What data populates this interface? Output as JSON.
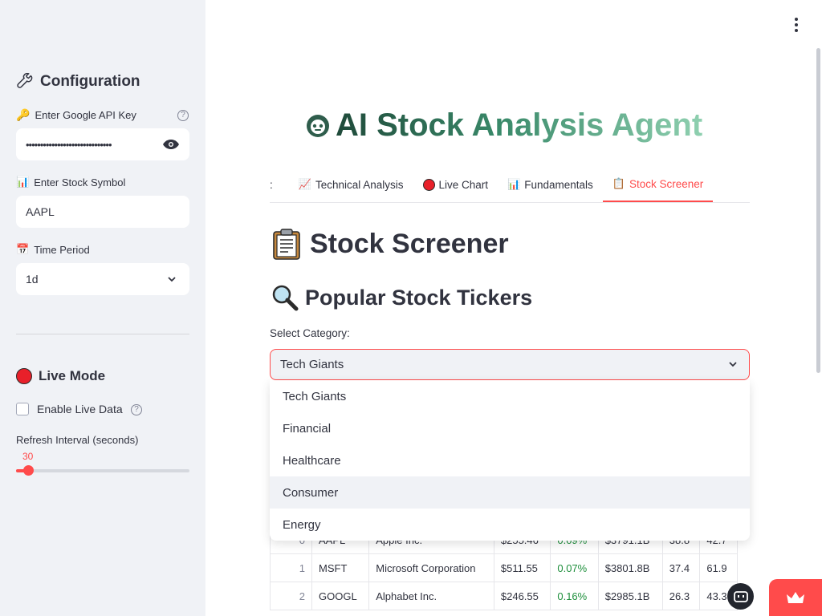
{
  "sidebar": {
    "config_heading": "Configuration",
    "api_key_label": "Enter Google API Key",
    "api_key_value": "••••••••••••••••••••••••••••••",
    "symbol_label": "Enter Stock Symbol",
    "symbol_value": "AAPL",
    "period_label": "Time Period",
    "period_value": "1d",
    "live_heading": "Live Mode",
    "live_checkbox_label": "Enable Live Data",
    "refresh_label": "Refresh Interval (seconds)",
    "refresh_value": "30",
    "refresh_fraction": 0.07
  },
  "main": {
    "title": "AI Stock Analysis Agent",
    "tabs": [
      {
        "label": ":"
      },
      {
        "label": "Technical Analysis"
      },
      {
        "label": "Live Chart"
      },
      {
        "label": "Fundamentals"
      },
      {
        "label": "Stock Screener"
      }
    ],
    "page_heading": "Stock Screener",
    "section_heading": "Popular Stock Tickers",
    "category_label": "Select Category:",
    "category_selected": "Tech Giants",
    "category_options": [
      "Tech Giants",
      "Financial",
      "Healthcare",
      "Consumer",
      "Energy"
    ],
    "table_rows": [
      {
        "idx": "0",
        "ticker": "AAPL",
        "name": "Apple Inc.",
        "price": "$255.46",
        "change": "0.09%",
        "cap": "$3791.1B",
        "pe": "38.8",
        "c7": "42.7"
      },
      {
        "idx": "1",
        "ticker": "MSFT",
        "name": "Microsoft Corporation",
        "price": "$511.55",
        "change": "0.07%",
        "cap": "$3801.8B",
        "pe": "37.4",
        "c7": "61.9"
      },
      {
        "idx": "2",
        "ticker": "GOOGL",
        "name": "Alphabet Inc.",
        "price": "$246.55",
        "change": "0.16%",
        "cap": "$2985.1B",
        "pe": "26.3",
        "c7": "43.3"
      }
    ]
  },
  "colors": {
    "accent": "#ff4b4b",
    "positive": "#1e8f3c",
    "sidebar_bg": "#f0f2f6"
  }
}
